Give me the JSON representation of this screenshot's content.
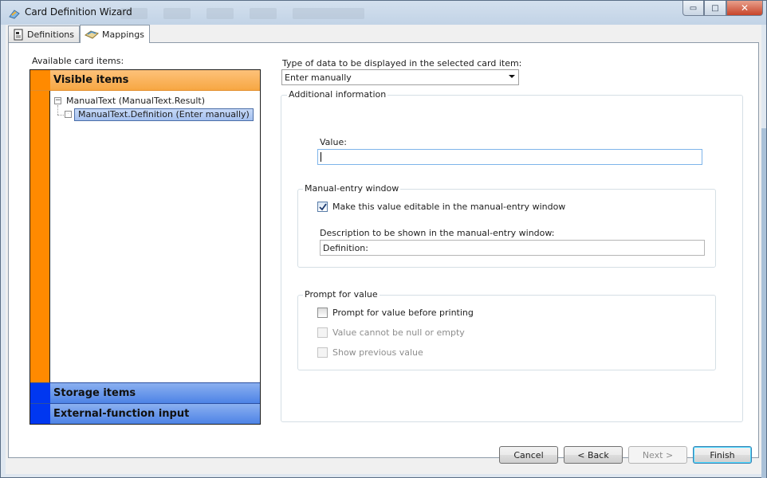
{
  "window": {
    "title": "Card Definition Wizard",
    "controls": {
      "minimize": "▭",
      "maximize": "□",
      "close": "✕"
    }
  },
  "tabs": [
    {
      "label": "Definitions",
      "active": false,
      "icon": "document-icon"
    },
    {
      "label": "Mappings",
      "active": true,
      "icon": "mapping-icon"
    }
  ],
  "left_panel": {
    "label": "Available card items:",
    "categories": {
      "visible": "Visible items",
      "storage": "Storage items",
      "external": "External-function input"
    },
    "colors": {
      "visible": "#ff8a00",
      "storage": "#0037f0",
      "external": "#0037f0"
    },
    "tree": {
      "root": {
        "expander": "−",
        "label": "ManualText (ManualText.Result)"
      },
      "child": {
        "expander": "·",
        "label": "ManualText.Definition (Enter manually)",
        "selected": true
      }
    }
  },
  "right_panel": {
    "type_label": "Type of data to be displayed in the selected card item:",
    "type_value": "Enter manually",
    "additional_title": "Additional information",
    "value_label": "Value:",
    "value_input": "",
    "manual_entry": {
      "title": "Manual-entry window",
      "editable_label": "Make this value editable in the manual-entry window",
      "editable_checked": true,
      "description_label": "Description to be shown in the manual-entry window:",
      "description_value": "Definition:"
    },
    "prompt": {
      "title": "Prompt for value",
      "prompt_label": "Prompt for value before printing",
      "prompt_checked": false,
      "not_null_label": "Value cannot be null or empty",
      "not_null_enabled": false,
      "show_previous_label": "Show previous value",
      "show_previous_enabled": false
    }
  },
  "footer": {
    "cancel": "Cancel",
    "back": "< Back",
    "next": "Next >",
    "finish": "Finish"
  }
}
